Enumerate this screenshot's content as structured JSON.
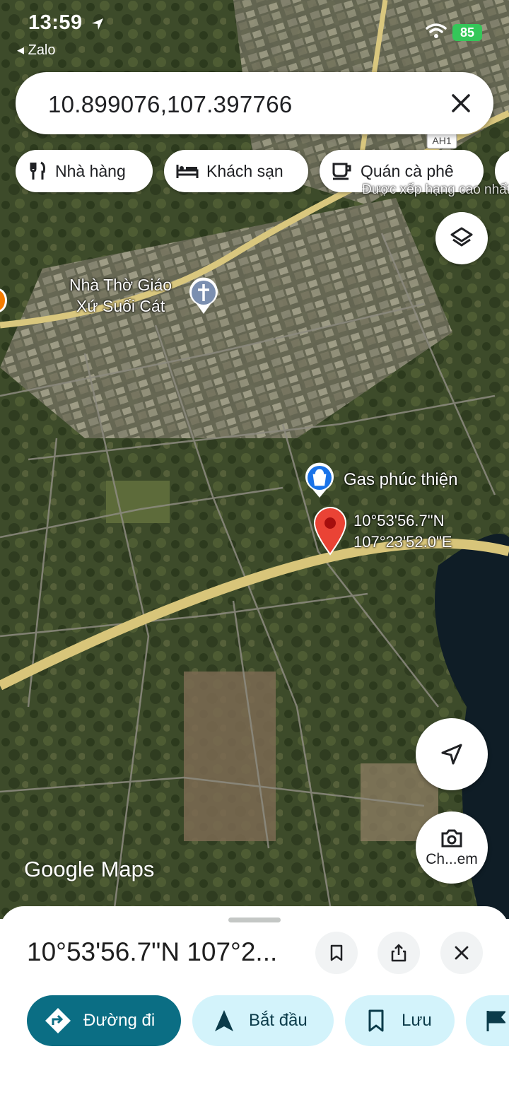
{
  "status": {
    "time": "13:59",
    "back_app": "◂ Zalo",
    "battery": "85"
  },
  "search": {
    "query": "10.899076,107.397766"
  },
  "chips": [
    {
      "label": "Nhà hàng",
      "icon": "restaurant-icon"
    },
    {
      "label": "Khách sạn",
      "icon": "hotel-icon"
    },
    {
      "label": "Quán cà phê",
      "icon": "coffee-icon"
    }
  ],
  "map": {
    "road_shield": "AH1",
    "partial_label": "Được xếp hạng cao nhất",
    "church_label_1": "Nhà Thờ Giáo",
    "church_label_2": "Xứ Suối Cát",
    "gas_label": "Gas phúc thiện",
    "pin_lat": "10°53'56.7\"N",
    "pin_lng": "107°23'52.0\"E",
    "streetview_label": "Ch...em",
    "logo": "Google Maps"
  },
  "sheet": {
    "title": "10°53'56.7\"N 107°2...",
    "actions": {
      "directions": "Đường đi",
      "start": "Bắt đầu",
      "save": "Lưu"
    }
  },
  "colors": {
    "accent": "#0b6e84",
    "chip_light": "#d3f3fb",
    "pin": "#ea4335"
  }
}
